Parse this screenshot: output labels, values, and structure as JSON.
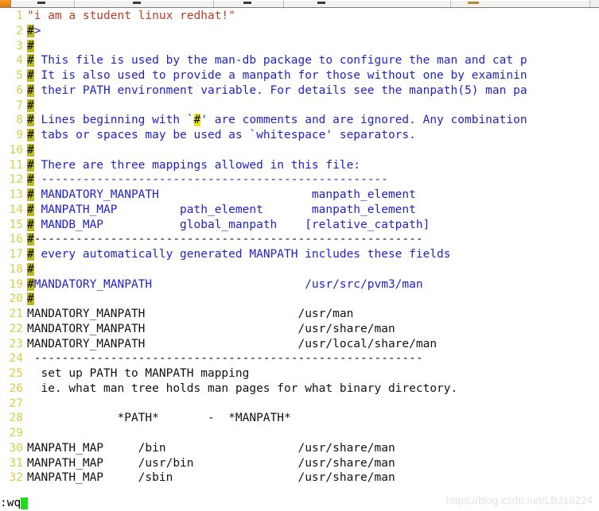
{
  "app": {
    "kind": "terminal-text-editor",
    "editor": "vi",
    "background": "#ffffff",
    "line_number_color": "#d2cf4c",
    "comment_color": "#2222cc",
    "string_color": "#c03a22",
    "hash_highlight_color": "#bdb822",
    "hash_highlight_bright_color": "#e9e619",
    "cursor_color": "#19e019"
  },
  "taskbar": {
    "buttons": [
      "",
      "",
      "",
      "",
      ""
    ]
  },
  "status": {
    "command": ":wq",
    "cursor": "block"
  },
  "watermark": {
    "text": "https://blog.csdn.net/LBJ19224"
  },
  "file": {
    "lines": [
      {
        "n": "1",
        "segments": [
          {
            "t": "\"i am a student linux redhat!\"",
            "c": "tk-red"
          }
        ]
      },
      {
        "n": "2",
        "segments": [
          {
            "t": "#",
            "c": "tk-hash-hl"
          },
          {
            "t": ">",
            "c": "tk-comment"
          }
        ]
      },
      {
        "n": "3",
        "segments": [
          {
            "t": "#",
            "c": "tk-hash-hl"
          }
        ]
      },
      {
        "n": "4",
        "segments": [
          {
            "t": "#",
            "c": "tk-hash-hl"
          },
          {
            "t": " This file is used by the man-db package to configure the man and cat p",
            "c": "tk-comment"
          }
        ]
      },
      {
        "n": "5",
        "segments": [
          {
            "t": "#",
            "c": "tk-hash-hl"
          },
          {
            "t": " It is also used to provide a manpath for those without one by examinin",
            "c": "tk-comment"
          }
        ]
      },
      {
        "n": "6",
        "segments": [
          {
            "t": "#",
            "c": "tk-hash-hl"
          },
          {
            "t": " their PATH environment variable. For details see the manpath(5) man pa",
            "c": "tk-comment"
          }
        ]
      },
      {
        "n": "7",
        "segments": [
          {
            "t": "#",
            "c": "tk-hash-hl"
          }
        ]
      },
      {
        "n": "8",
        "segments": [
          {
            "t": "#",
            "c": "tk-hash-hl"
          },
          {
            "t": " Lines beginning with `",
            "c": "tk-comment"
          },
          {
            "t": "#",
            "c": "tk-hash-hl-bright"
          },
          {
            "t": "' are comments and are ignored. Any combination",
            "c": "tk-comment"
          }
        ]
      },
      {
        "n": "9",
        "segments": [
          {
            "t": "#",
            "c": "tk-hash-hl"
          },
          {
            "t": " tabs or spaces may be used as `whitespace' separators.",
            "c": "tk-comment"
          }
        ]
      },
      {
        "n": "10",
        "segments": [
          {
            "t": "#",
            "c": "tk-hash-hl"
          }
        ]
      },
      {
        "n": "11",
        "segments": [
          {
            "t": "#",
            "c": "tk-hash-hl"
          },
          {
            "t": " There are three mappings allowed in this file:",
            "c": "tk-comment"
          }
        ]
      },
      {
        "n": "12",
        "segments": [
          {
            "t": "#",
            "c": "tk-hash-hl"
          },
          {
            "t": " --------------------------------------------------",
            "c": "tk-comment"
          }
        ]
      },
      {
        "n": "13",
        "segments": [
          {
            "t": "#",
            "c": "tk-hash-hl"
          },
          {
            "t": " MANDATORY_MANPATH                      manpath_element",
            "c": "tk-comment"
          }
        ]
      },
      {
        "n": "14",
        "segments": [
          {
            "t": "#",
            "c": "tk-hash-hl"
          },
          {
            "t": " MANPATH_MAP         path_element       manpath_element",
            "c": "tk-comment"
          }
        ]
      },
      {
        "n": "15",
        "segments": [
          {
            "t": "#",
            "c": "tk-hash-hl"
          },
          {
            "t": " MANDB_MAP           global_manpath    [relative_catpath]",
            "c": "tk-comment"
          }
        ]
      },
      {
        "n": "16",
        "segments": [
          {
            "t": "#",
            "c": "tk-hash-hl"
          },
          {
            "t": "--------------------------------------------------------",
            "c": "tk-plain"
          }
        ]
      },
      {
        "n": "17",
        "segments": [
          {
            "t": "#",
            "c": "tk-hash-hl"
          },
          {
            "t": " every automatically generated MANPATH includes these fields",
            "c": "tk-comment"
          }
        ]
      },
      {
        "n": "18",
        "segments": [
          {
            "t": "#",
            "c": "tk-hash-hl"
          }
        ]
      },
      {
        "n": "19",
        "segments": [
          {
            "t": "#",
            "c": "tk-hash-hl"
          },
          {
            "t": "MANDATORY_MANPATH                      /usr/src/pvm3/man",
            "c": "tk-comment"
          }
        ]
      },
      {
        "n": "20",
        "segments": [
          {
            "t": "#",
            "c": "tk-hash-hl"
          }
        ]
      },
      {
        "n": "21",
        "segments": [
          {
            "t": "MANDATORY_MANPATH                      /usr/man",
            "c": "tk-plain"
          }
        ]
      },
      {
        "n": "22",
        "segments": [
          {
            "t": "MANDATORY_MANPATH                      /usr/share/man",
            "c": "tk-plain"
          }
        ]
      },
      {
        "n": "23",
        "segments": [
          {
            "t": "MANDATORY_MANPATH                      /usr/local/share/man",
            "c": "tk-plain"
          }
        ]
      },
      {
        "n": "24",
        "segments": [
          {
            "t": " --------------------------------------------------------",
            "c": "tk-plain"
          }
        ]
      },
      {
        "n": "25",
        "segments": [
          {
            "t": "  set up PATH to MANPATH mapping",
            "c": "tk-plain"
          }
        ]
      },
      {
        "n": "26",
        "segments": [
          {
            "t": "  ie. what man tree holds man pages for what binary directory.",
            "c": "tk-plain"
          }
        ]
      },
      {
        "n": "27",
        "segments": [
          {
            "t": "",
            "c": "tk-plain"
          }
        ]
      },
      {
        "n": "28",
        "segments": [
          {
            "t": "             *PATH*       -  *MANPATH*",
            "c": "tk-plain"
          }
        ]
      },
      {
        "n": "29",
        "segments": [
          {
            "t": "",
            "c": "tk-plain"
          }
        ]
      },
      {
        "n": "30",
        "segments": [
          {
            "t": "MANPATH_MAP     /bin                   /usr/share/man",
            "c": "tk-plain"
          }
        ]
      },
      {
        "n": "31",
        "segments": [
          {
            "t": "MANPATH_MAP     /usr/bin               /usr/share/man",
            "c": "tk-plain"
          }
        ]
      },
      {
        "n": "32",
        "segments": [
          {
            "t": "MANPATH_MAP     /sbin                  /usr/share/man",
            "c": "tk-plain"
          }
        ]
      }
    ]
  }
}
